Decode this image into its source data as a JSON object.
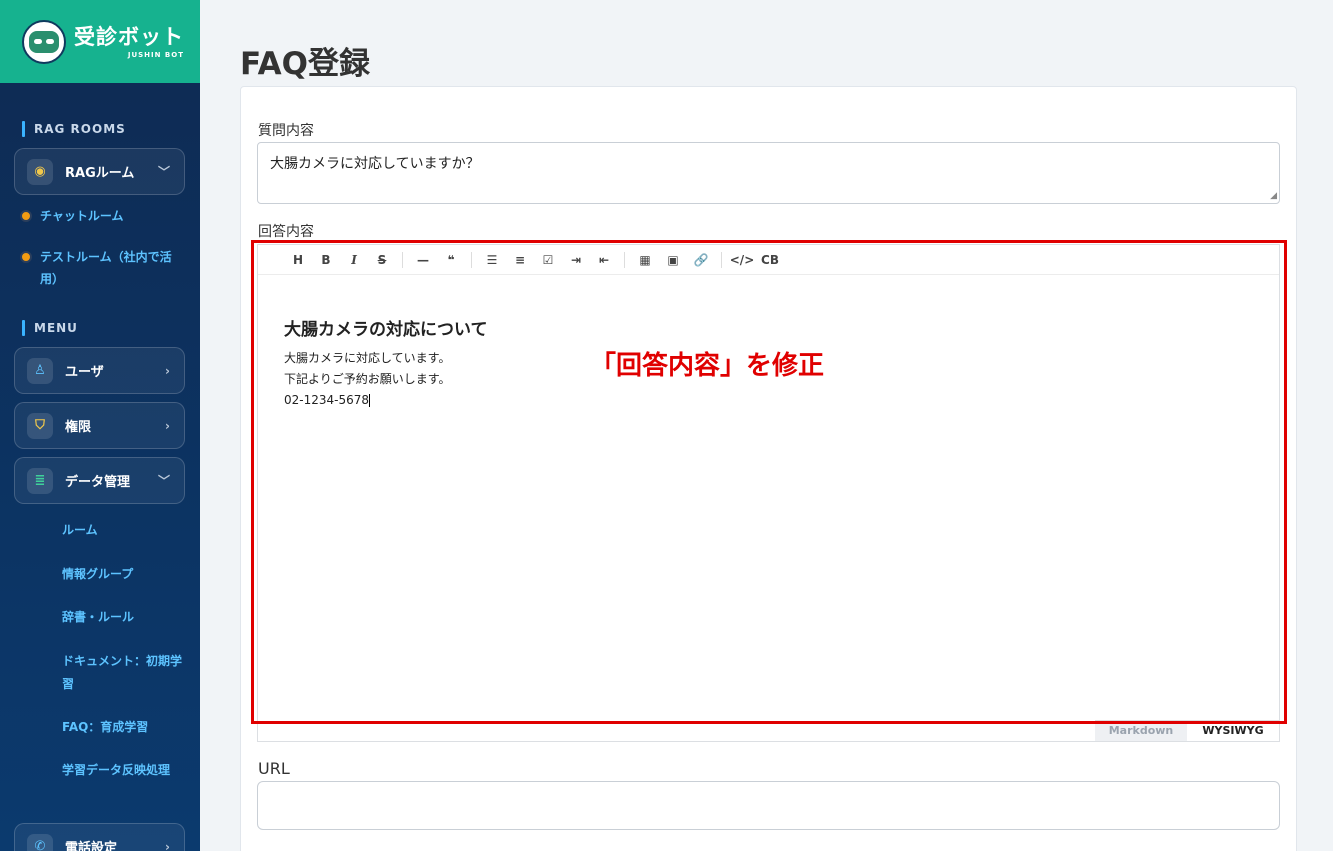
{
  "logo": {
    "title": "受診ボット",
    "subtitle": "JUSHIN BOT"
  },
  "sidebar": {
    "rag_section": "RAG ROOMS",
    "rag_room": "RAGルーム",
    "rag_children": [
      "チャットルーム",
      "テストルーム（社内で活用）"
    ],
    "menu_section": "MENU",
    "menu_items": [
      "ユーザ",
      "権限",
      "データ管理"
    ],
    "data_children": [
      "ルーム",
      "情報グループ",
      "辞書・ルール",
      "ドキュメント：初期学習",
      "FAQ：育成学習",
      "学習データ反映処理"
    ],
    "phone": "電話設定"
  },
  "page": {
    "title": "FAQ登録"
  },
  "form": {
    "question_label": "質問内容",
    "question_value": "大腸カメラに対応していますか？",
    "answer_label": "回答内容",
    "answer": {
      "heading": "大腸カメラの対応について",
      "lines": [
        "大腸カメラに対応しています。",
        "下記よりご予約お願いします。",
        "02-1234-5678"
      ]
    },
    "modes": {
      "markdown": "Markdown",
      "wysiwyg": "WYSIWYG"
    },
    "url_label": "URL"
  },
  "toolbar": [
    "H",
    "B",
    "I",
    "S",
    "—",
    "❝",
    "☰",
    "≡",
    "☑",
    "⇥",
    "⇤",
    "▦",
    "▣",
    "🔗",
    "</>",
    "CB"
  ],
  "annotation": "「回答内容」を修正",
  "colors": {
    "accent": "#16b28f",
    "annotation": "#e00000"
  }
}
